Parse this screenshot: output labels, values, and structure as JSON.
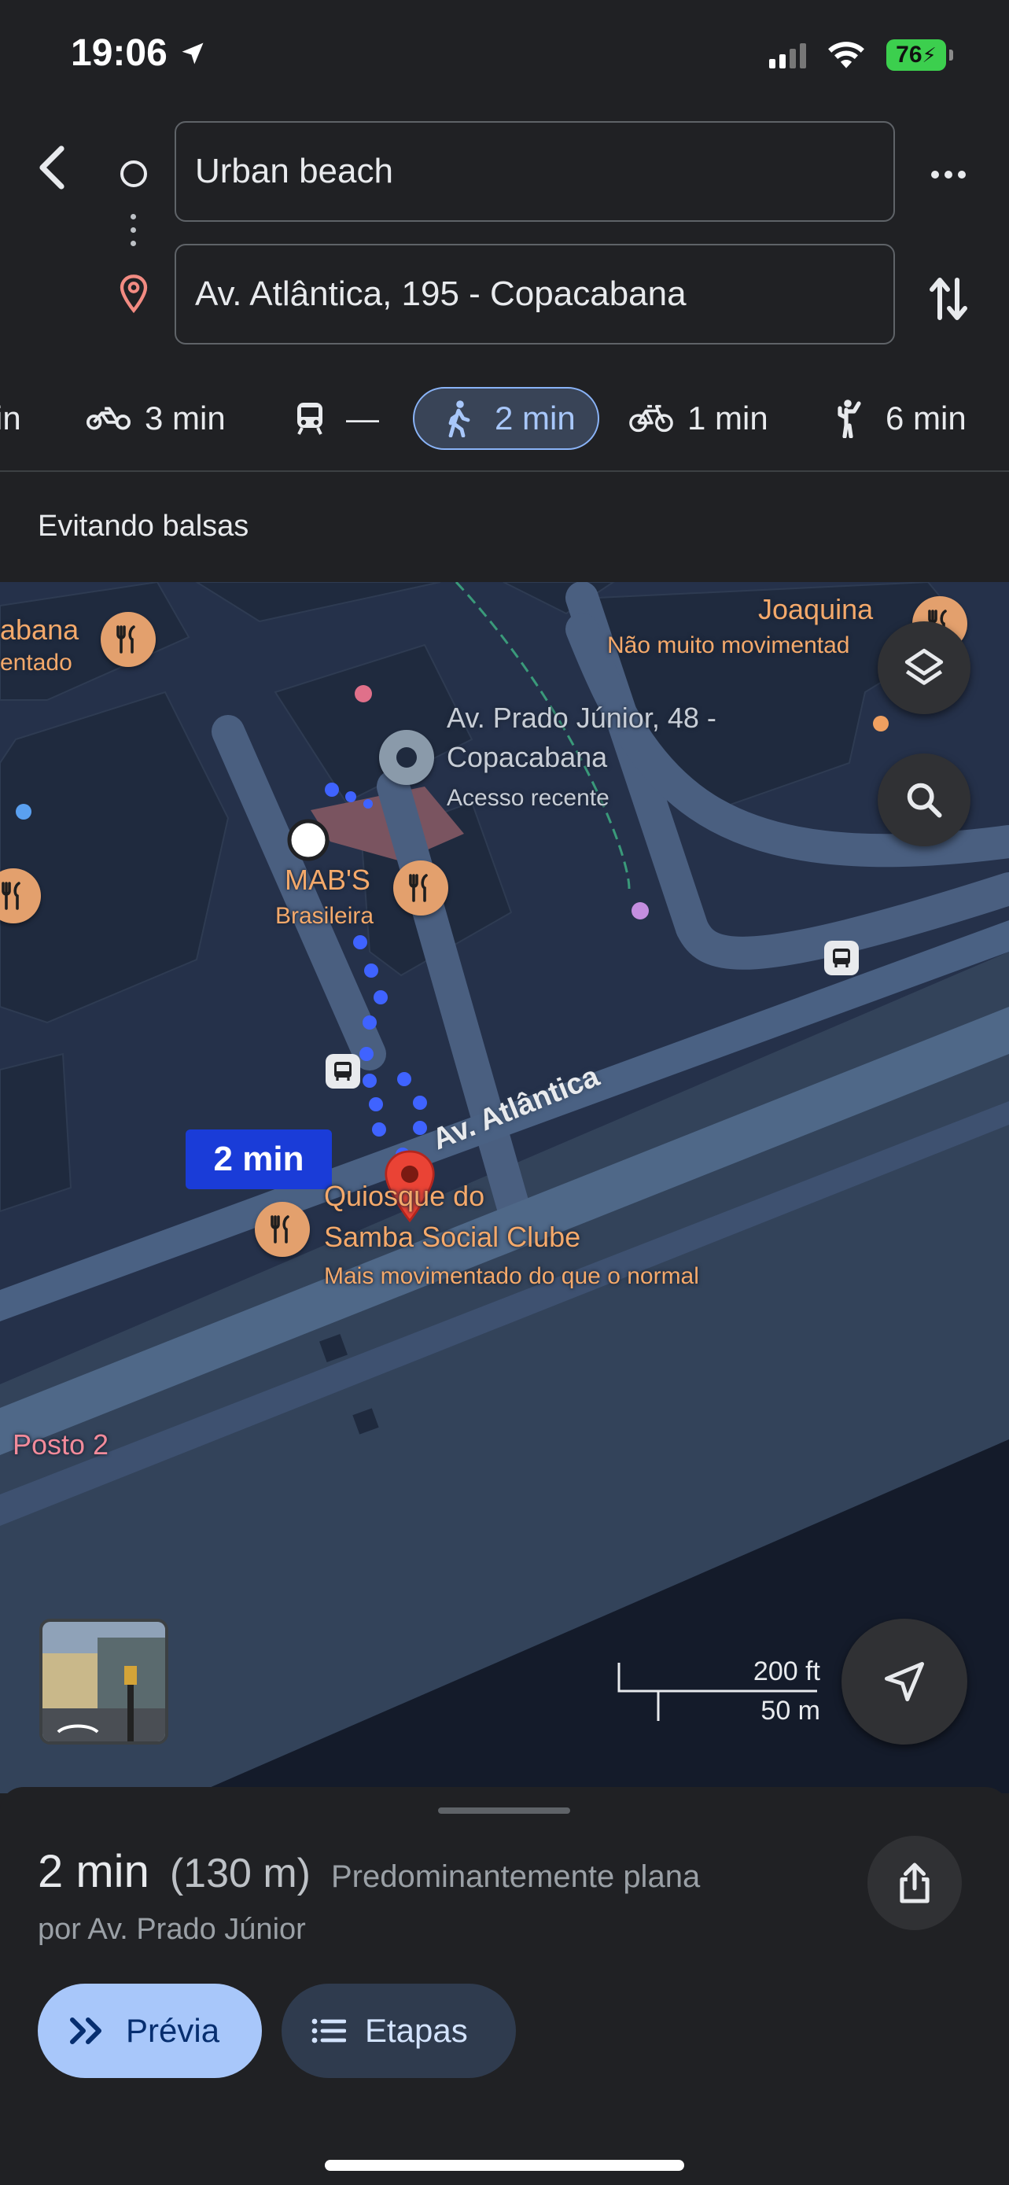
{
  "status_bar": {
    "time": "19:06",
    "battery": "76",
    "icons": [
      "location-arrow-icon",
      "signal-icon",
      "wifi-icon",
      "battery-icon"
    ]
  },
  "route": {
    "origin": "Urban beach",
    "destination": "Av. Atlântica, 195 - Copacabana"
  },
  "modes": [
    {
      "icon": "car-icon",
      "label": "in"
    },
    {
      "icon": "motorcycle-icon",
      "label": "3 min"
    },
    {
      "icon": "transit-icon",
      "label": "—"
    },
    {
      "icon": "walk-icon",
      "label": "2 min",
      "selected": true
    },
    {
      "icon": "bike-icon",
      "label": "1 min"
    },
    {
      "icon": "ride-hail-icon",
      "label": "6 min"
    }
  ],
  "route_note": "Evitando balsas",
  "map": {
    "labels": {
      "poi_left_top": "abana",
      "poi_left_sub": "entado",
      "poi_joaquina": "Joaquina",
      "poi_joaquina_sub": "Não muito movimentad",
      "prado_title_1": "Av. Prado Júnior, 48 -",
      "prado_title_2": "Copacabana",
      "prado_sub": "Acesso recente",
      "mabs": "MAB'S",
      "mabs_sub": "Brasileira",
      "street": "Av. Atlântica",
      "quiosque_1": "Quiosque do",
      "quiosque_2": "Samba Social Clube",
      "quiosque_sub": "Mais movimentado do que o normal",
      "posto": "Posto 2"
    },
    "route_time_chip": "2 min",
    "scale": {
      "imperial": "200 ft",
      "metric": "50 m"
    },
    "colors": {
      "route": "#4169ff",
      "poi": "#e3a06d",
      "pin": "#ea4335"
    }
  },
  "summary": {
    "time": "2 min",
    "distance": "(130 m)",
    "terrain": "Predominantemente plana",
    "via": "por Av. Prado Júnior"
  },
  "actions": {
    "preview": "Prévia",
    "steps": "Etapas"
  }
}
